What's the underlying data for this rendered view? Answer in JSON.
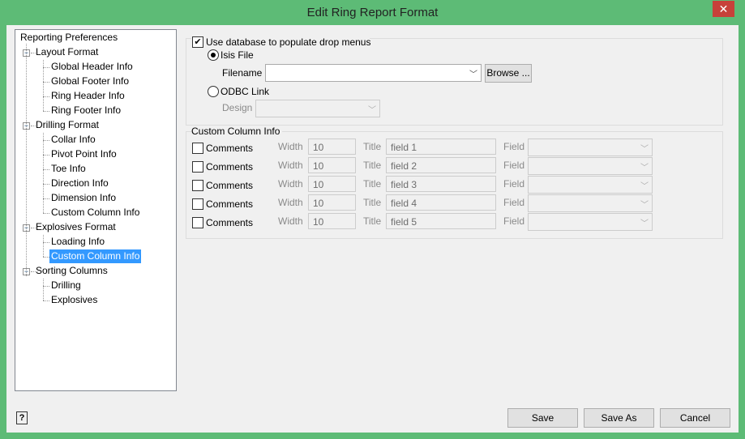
{
  "window": {
    "title": "Edit Ring Report Format",
    "close": "✕"
  },
  "tree": {
    "root": "Reporting Preferences",
    "groups": [
      {
        "label": "Layout Format",
        "items": [
          "Global Header Info",
          "Global Footer Info",
          "Ring Header Info",
          "Ring Footer Info"
        ]
      },
      {
        "label": "Drilling Format",
        "items": [
          "Collar Info",
          "Pivot Point Info",
          "Toe Info",
          "Direction Info",
          "Dimension Info",
          "Custom Column Info"
        ]
      },
      {
        "label": "Explosives Format",
        "items": [
          "Loading Info",
          "Custom Column Info"
        ]
      },
      {
        "label": "Sorting Columns",
        "items": [
          "Drilling",
          "Explosives"
        ]
      }
    ],
    "selected": "Explosives Format/Custom Column Info"
  },
  "database": {
    "use_db_label": "Use database to populate drop menus",
    "use_db_checked": true,
    "isis_label": "Isis File",
    "filename_label": "Filename",
    "filename_value": "",
    "browse_label": "Browse ...",
    "odbc_label": "ODBC Link",
    "design_label": "Design",
    "design_value": ""
  },
  "custom": {
    "title": "Custom Column Info",
    "width_label": "Width",
    "title_label": "Title",
    "field_label": "Field",
    "rows": [
      {
        "label": "Comments",
        "width": "10",
        "title": "field 1",
        "field": ""
      },
      {
        "label": "Comments",
        "width": "10",
        "title": "field 2",
        "field": ""
      },
      {
        "label": "Comments",
        "width": "10",
        "title": "field 3",
        "field": ""
      },
      {
        "label": "Comments",
        "width": "10",
        "title": "field 4",
        "field": ""
      },
      {
        "label": "Comments",
        "width": "10",
        "title": "field 5",
        "field": ""
      }
    ]
  },
  "buttons": {
    "save": "Save",
    "save_as": "Save As",
    "cancel": "Cancel",
    "help": "?"
  }
}
